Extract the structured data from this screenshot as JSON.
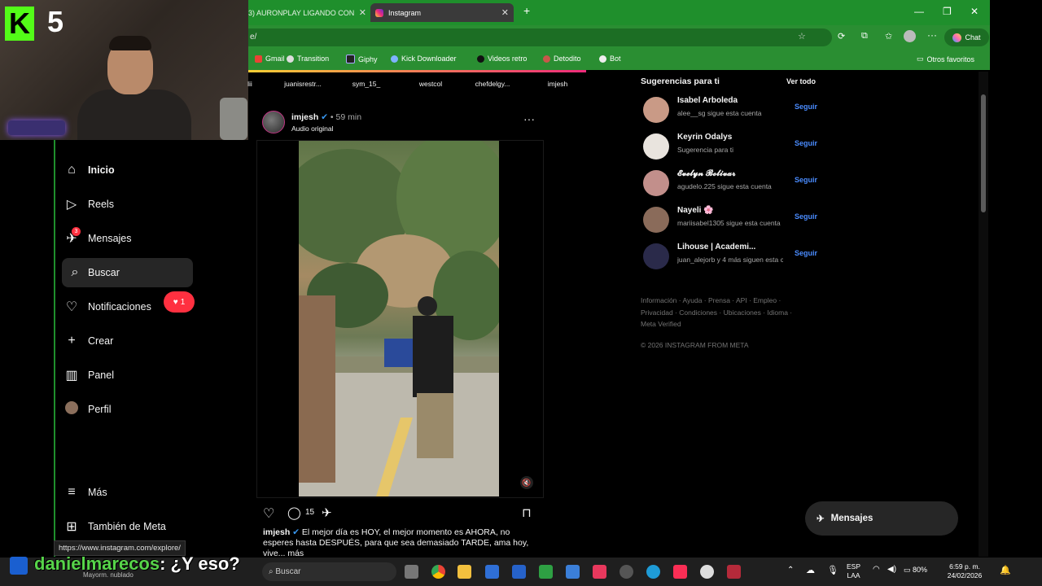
{
  "browser": {
    "inactive_tab": "3) AURONPLAY LIGANDO CON",
    "active_tab": "Instagram",
    "url": "e/",
    "chat_label": "Chat",
    "bookmarks": [
      "Gmail",
      "Transition",
      "Giphy",
      "Kick Downloader",
      "Videos retro",
      "Detodito",
      "Bot"
    ],
    "other_favorites": "Otros favoritos"
  },
  "overlay": {
    "logo_letter": "K",
    "logo_number": "5"
  },
  "nav": {
    "items": [
      {
        "label": "Inicio",
        "icon": "home-icon"
      },
      {
        "label": "Reels",
        "icon": "reels-icon"
      },
      {
        "label": "Mensajes",
        "icon": "messages-icon",
        "badge": "3"
      },
      {
        "label": "Buscar",
        "icon": "search-icon"
      },
      {
        "label": "Notificaciones",
        "icon": "heart-icon",
        "pill": "1"
      },
      {
        "label": "Crear",
        "icon": "plus-icon"
      },
      {
        "label": "Panel",
        "icon": "dashboard-icon"
      },
      {
        "label": "Perfil",
        "icon": "profile-avatar"
      },
      {
        "label": "Más",
        "icon": "menu-icon"
      },
      {
        "label": "También de Meta",
        "icon": "meta-icon"
      }
    ]
  },
  "stories": [
    "lii",
    "juanisrestr...",
    "sym_15_",
    "westcol",
    "chefdelgy...",
    "imjesh"
  ],
  "post": {
    "username": "imjesh",
    "time": "59 min",
    "audio": "Audio original",
    "comments_count": "15",
    "caption_user": "imjesh",
    "caption_text": "El mejor día es HOY, el mejor momento es AHORA, no esperes hasta DESPUÉS, para que sea demasiado TARDE, ama hoy, vive... más"
  },
  "suggestions": {
    "title": "Sugerencias para ti",
    "see_all": "Ver todo",
    "follow_label": "Seguir",
    "items": [
      {
        "name": "Isabel Arboleda",
        "sub": "alee__sg sigue esta cuenta",
        "color": "#c99a86"
      },
      {
        "name": "Keyrin Odalys",
        "sub": "Sugerencia para ti",
        "color": "#e9e4de"
      },
      {
        "name": "𝓔𝓿𝓮𝓵𝔂𝓷 𝓑𝓸𝓵𝓲𝓿𝓪𝓻",
        "sub": "agudelo.225 sigue esta cuenta",
        "color": "#c28f8b"
      },
      {
        "name": "Nayeli 🌸",
        "sub": "mariisabel1305 sigue esta cuenta",
        "color": "#8a6b5a"
      },
      {
        "name": "Lihouse | Academi...",
        "sub": "juan_alejorb y 4 más siguen esta cuenta",
        "color": "#2a2a4a"
      }
    ]
  },
  "footer": {
    "links": "Información · Ayuda · Prensa · API · Empleo · Privacidad · Condiciones · Ubicaciones · Idioma · Meta Verified",
    "copyright": "© 2026 INSTAGRAM FROM META"
  },
  "messages_pill": "Mensajes",
  "status_url": "https://www.instagram.com/explore/",
  "stream_chat": {
    "user": "danielmarecos",
    "message": ": ¿Y eso?"
  },
  "taskbar": {
    "weather": "Mayorm. nublado",
    "search_placeholder": "Buscar",
    "language": "ESP",
    "layout": "LAA",
    "battery": "80%",
    "time": "6:59 p. m.",
    "date": "24/02/2026"
  }
}
